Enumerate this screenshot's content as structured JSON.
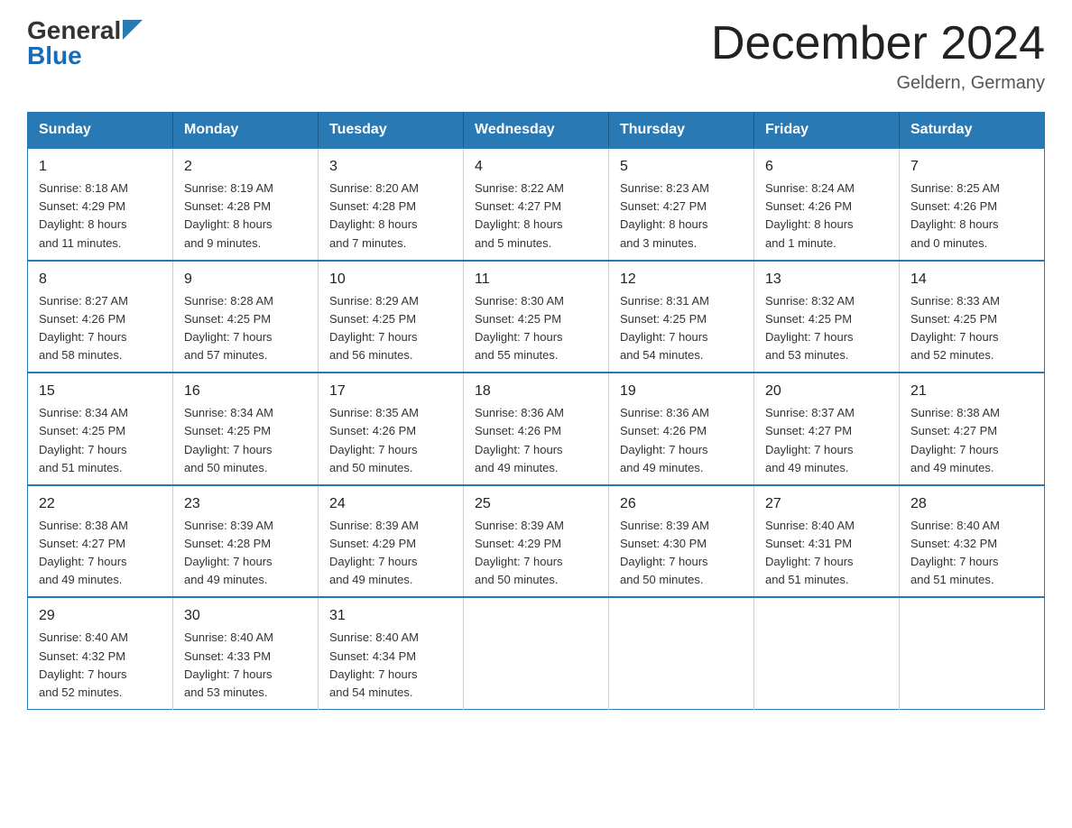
{
  "header": {
    "logo_line1": "General",
    "logo_line2": "Blue",
    "title": "December 2024",
    "subtitle": "Geldern, Germany"
  },
  "columns": [
    "Sunday",
    "Monday",
    "Tuesday",
    "Wednesday",
    "Thursday",
    "Friday",
    "Saturday"
  ],
  "weeks": [
    [
      {
        "day": "1",
        "info": "Sunrise: 8:18 AM\nSunset: 4:29 PM\nDaylight: 8 hours\nand 11 minutes."
      },
      {
        "day": "2",
        "info": "Sunrise: 8:19 AM\nSunset: 4:28 PM\nDaylight: 8 hours\nand 9 minutes."
      },
      {
        "day": "3",
        "info": "Sunrise: 8:20 AM\nSunset: 4:28 PM\nDaylight: 8 hours\nand 7 minutes."
      },
      {
        "day": "4",
        "info": "Sunrise: 8:22 AM\nSunset: 4:27 PM\nDaylight: 8 hours\nand 5 minutes."
      },
      {
        "day": "5",
        "info": "Sunrise: 8:23 AM\nSunset: 4:27 PM\nDaylight: 8 hours\nand 3 minutes."
      },
      {
        "day": "6",
        "info": "Sunrise: 8:24 AM\nSunset: 4:26 PM\nDaylight: 8 hours\nand 1 minute."
      },
      {
        "day": "7",
        "info": "Sunrise: 8:25 AM\nSunset: 4:26 PM\nDaylight: 8 hours\nand 0 minutes."
      }
    ],
    [
      {
        "day": "8",
        "info": "Sunrise: 8:27 AM\nSunset: 4:26 PM\nDaylight: 7 hours\nand 58 minutes."
      },
      {
        "day": "9",
        "info": "Sunrise: 8:28 AM\nSunset: 4:25 PM\nDaylight: 7 hours\nand 57 minutes."
      },
      {
        "day": "10",
        "info": "Sunrise: 8:29 AM\nSunset: 4:25 PM\nDaylight: 7 hours\nand 56 minutes."
      },
      {
        "day": "11",
        "info": "Sunrise: 8:30 AM\nSunset: 4:25 PM\nDaylight: 7 hours\nand 55 minutes."
      },
      {
        "day": "12",
        "info": "Sunrise: 8:31 AM\nSunset: 4:25 PM\nDaylight: 7 hours\nand 54 minutes."
      },
      {
        "day": "13",
        "info": "Sunrise: 8:32 AM\nSunset: 4:25 PM\nDaylight: 7 hours\nand 53 minutes."
      },
      {
        "day": "14",
        "info": "Sunrise: 8:33 AM\nSunset: 4:25 PM\nDaylight: 7 hours\nand 52 minutes."
      }
    ],
    [
      {
        "day": "15",
        "info": "Sunrise: 8:34 AM\nSunset: 4:25 PM\nDaylight: 7 hours\nand 51 minutes."
      },
      {
        "day": "16",
        "info": "Sunrise: 8:34 AM\nSunset: 4:25 PM\nDaylight: 7 hours\nand 50 minutes."
      },
      {
        "day": "17",
        "info": "Sunrise: 8:35 AM\nSunset: 4:26 PM\nDaylight: 7 hours\nand 50 minutes."
      },
      {
        "day": "18",
        "info": "Sunrise: 8:36 AM\nSunset: 4:26 PM\nDaylight: 7 hours\nand 49 minutes."
      },
      {
        "day": "19",
        "info": "Sunrise: 8:36 AM\nSunset: 4:26 PM\nDaylight: 7 hours\nand 49 minutes."
      },
      {
        "day": "20",
        "info": "Sunrise: 8:37 AM\nSunset: 4:27 PM\nDaylight: 7 hours\nand 49 minutes."
      },
      {
        "day": "21",
        "info": "Sunrise: 8:38 AM\nSunset: 4:27 PM\nDaylight: 7 hours\nand 49 minutes."
      }
    ],
    [
      {
        "day": "22",
        "info": "Sunrise: 8:38 AM\nSunset: 4:27 PM\nDaylight: 7 hours\nand 49 minutes."
      },
      {
        "day": "23",
        "info": "Sunrise: 8:39 AM\nSunset: 4:28 PM\nDaylight: 7 hours\nand 49 minutes."
      },
      {
        "day": "24",
        "info": "Sunrise: 8:39 AM\nSunset: 4:29 PM\nDaylight: 7 hours\nand 49 minutes."
      },
      {
        "day": "25",
        "info": "Sunrise: 8:39 AM\nSunset: 4:29 PM\nDaylight: 7 hours\nand 50 minutes."
      },
      {
        "day": "26",
        "info": "Sunrise: 8:39 AM\nSunset: 4:30 PM\nDaylight: 7 hours\nand 50 minutes."
      },
      {
        "day": "27",
        "info": "Sunrise: 8:40 AM\nSunset: 4:31 PM\nDaylight: 7 hours\nand 51 minutes."
      },
      {
        "day": "28",
        "info": "Sunrise: 8:40 AM\nSunset: 4:32 PM\nDaylight: 7 hours\nand 51 minutes."
      }
    ],
    [
      {
        "day": "29",
        "info": "Sunrise: 8:40 AM\nSunset: 4:32 PM\nDaylight: 7 hours\nand 52 minutes."
      },
      {
        "day": "30",
        "info": "Sunrise: 8:40 AM\nSunset: 4:33 PM\nDaylight: 7 hours\nand 53 minutes."
      },
      {
        "day": "31",
        "info": "Sunrise: 8:40 AM\nSunset: 4:34 PM\nDaylight: 7 hours\nand 54 minutes."
      },
      {
        "day": "",
        "info": ""
      },
      {
        "day": "",
        "info": ""
      },
      {
        "day": "",
        "info": ""
      },
      {
        "day": "",
        "info": ""
      }
    ]
  ]
}
